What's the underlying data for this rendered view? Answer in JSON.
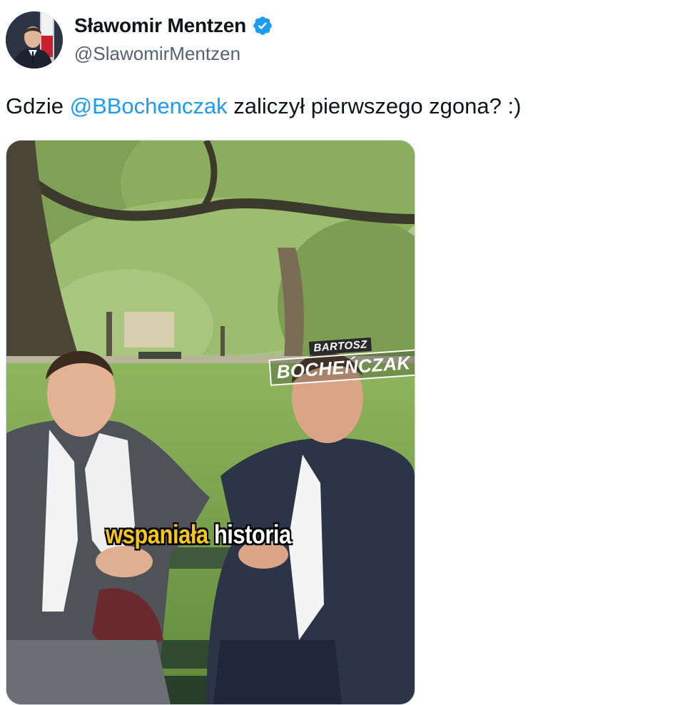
{
  "author": {
    "display_name": "Sławomir Mentzen",
    "handle": "@SlawomirMentzen",
    "verified": true,
    "avatar_icon": "user-avatar",
    "verified_icon": "verified-badge-icon"
  },
  "tweet": {
    "text_before": "Gdzie ",
    "mention": "@BBochenczak",
    "text_after": " zaliczył pierwszego zgona? :)"
  },
  "media": {
    "type": "video-thumbnail",
    "brand_small": "BARTOSZ",
    "brand_big": "BOCHEŃCZAK",
    "caption_highlight": "wspaniała",
    "caption_rest": "historia"
  },
  "colors": {
    "link": "#1d9bf0",
    "verified": "#1d9bf0",
    "handle": "#536471",
    "caption_highlight": "#f5c518"
  }
}
